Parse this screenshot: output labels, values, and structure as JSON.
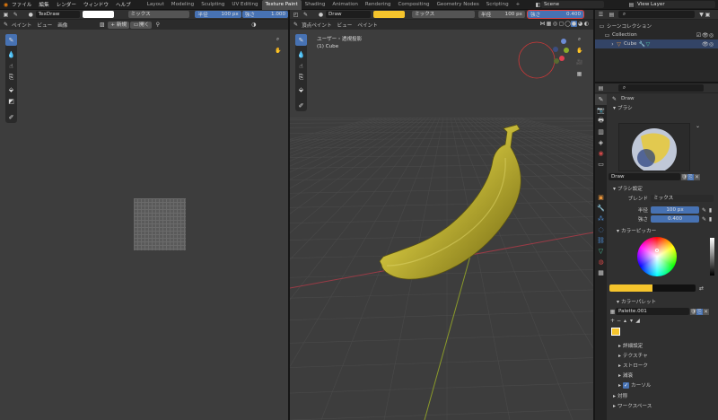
{
  "menu": [
    "ファイル",
    "編集",
    "レンダー",
    "ウィンドウ",
    "ヘルプ"
  ],
  "workspaces": [
    "Layout",
    "Modeling",
    "Sculpting",
    "UV Editing",
    "Texture Paint",
    "Shading",
    "Animation",
    "Rendering",
    "Compositing",
    "Geometry Nodes",
    "Scripting"
  ],
  "active_workspace": "Texture Paint",
  "add_workspace": "+",
  "scene": "Scene",
  "view_layer": "View Layer",
  "image_editor": {
    "brush_name": "TexDraw",
    "blend": "ミックス",
    "radius_label": "半径",
    "radius_value": "100 px",
    "strength_label": "強さ",
    "strength_value": "1.000",
    "menus": [
      "ペイント",
      "ビュー",
      "画像"
    ],
    "new_label": "新規",
    "open_label": "開く"
  },
  "viewport": {
    "brush_name": "Draw",
    "blend": "ミックス",
    "radius_label": "半径",
    "radius_value": "100 px",
    "strength_label": "強さ",
    "strength_value": "0.400",
    "mode": "頂点ペイント",
    "menus": [
      "ビュー",
      "ペイント"
    ],
    "view_label": "ユーザー・透視投影",
    "object_label": "(1) Cube",
    "gizmo": {
      "x": "X",
      "y": "Y",
      "z": "Z"
    }
  },
  "outliner": {
    "title": "シーンコレクション",
    "collection": "Collection",
    "object": "Cube"
  },
  "properties": {
    "tool_name": "Draw",
    "brush_section": "ブラシ",
    "brush_name": "Draw",
    "brush_settings": "ブラシ設定",
    "blend_label": "ブレンド",
    "blend_value": "ミックス",
    "radius_label": "半径",
    "radius_value": "100 px",
    "strength_label": "強さ",
    "strength_value": "0.400",
    "color_picker": "カラーピッカー",
    "color_palette": "カラーパレット",
    "palette_name": "Palette.001",
    "sections": [
      "詳細設定",
      "テクスチャ",
      "ストローク",
      "減衰"
    ],
    "cursor_label": "カーソル",
    "symmetry": "対称",
    "workspace": "ワークスペース"
  },
  "colors": {
    "accent": "#4772b3",
    "brush_color": "#f5c42c",
    "highlight": "#e04040"
  }
}
